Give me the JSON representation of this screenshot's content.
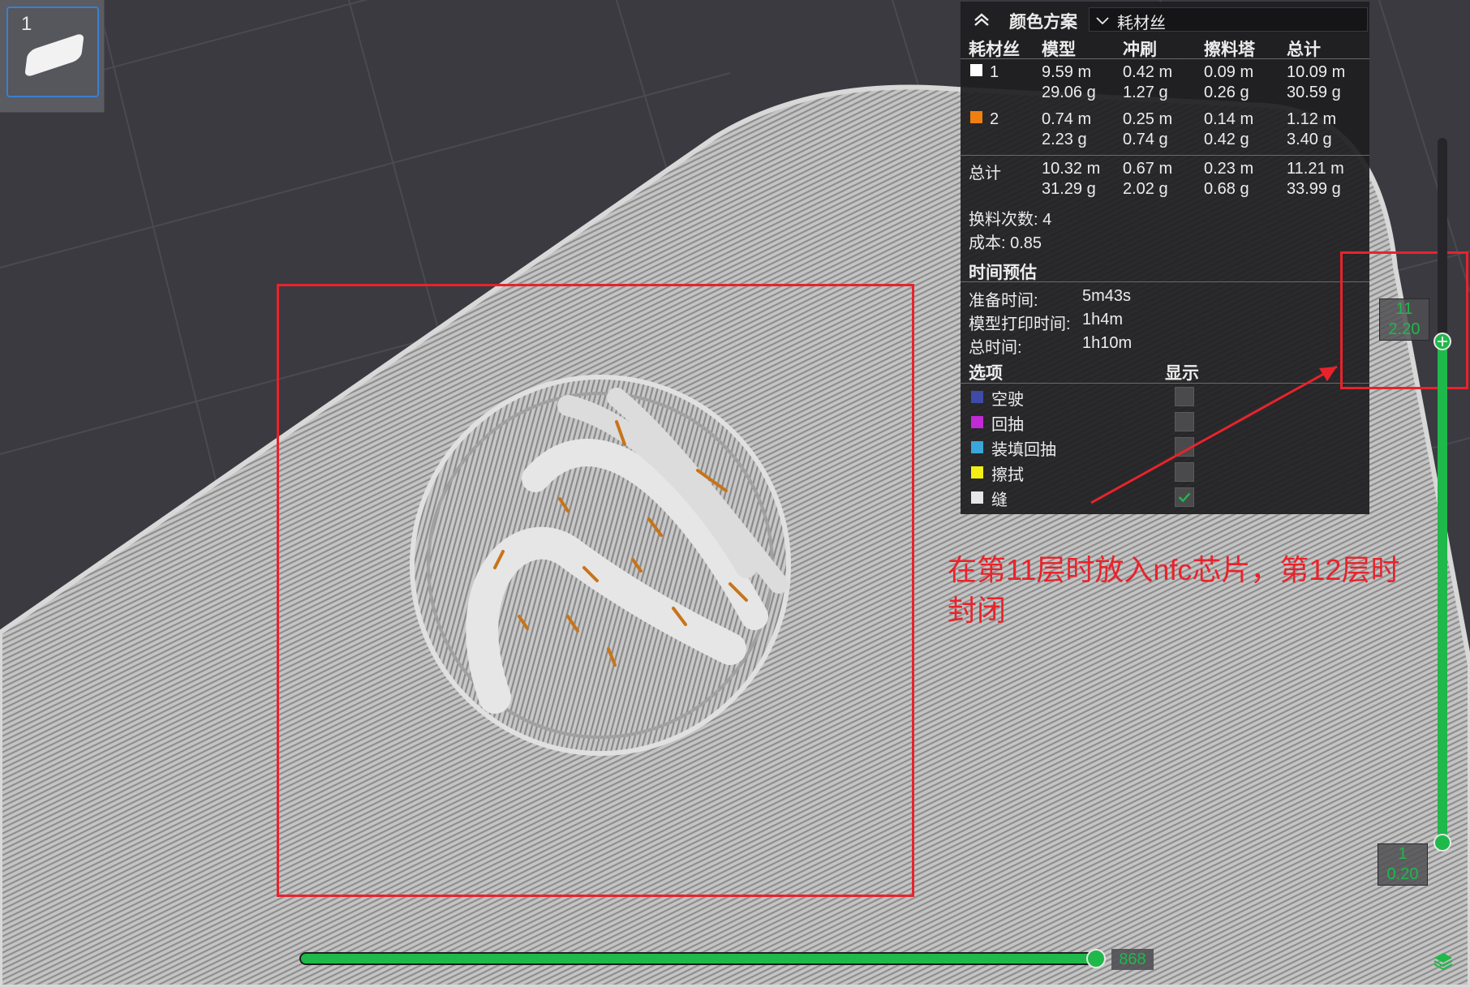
{
  "plate": {
    "number": "1"
  },
  "panel": {
    "scheme_title": "颜色方案",
    "scheme_value": "耗材丝",
    "columns": [
      "耗材丝",
      "模型",
      "冲刷",
      "擦料塔",
      "总计"
    ],
    "filaments": [
      {
        "id": "1",
        "color": "#ffffff",
        "model": [
          "9.59 m",
          "29.06 g"
        ],
        "flush": [
          "0.42 m",
          "1.27 g"
        ],
        "tower": [
          "0.09 m",
          "0.26 g"
        ],
        "total": [
          "10.09 m",
          "30.59 g"
        ]
      },
      {
        "id": "2",
        "color": "#f07f12",
        "model": [
          "0.74 m",
          "2.23 g"
        ],
        "flush": [
          "0.25 m",
          "0.74 g"
        ],
        "tower": [
          "0.14 m",
          "0.42 g"
        ],
        "total": [
          "1.12 m",
          "3.40 g"
        ]
      }
    ],
    "total_row": {
      "label": "总计",
      "model": [
        "10.32 m",
        "31.29 g"
      ],
      "flush": [
        "0.67 m",
        "2.02 g"
      ],
      "tower": [
        "0.23 m",
        "0.68 g"
      ],
      "total": [
        "11.21 m",
        "33.99 g"
      ]
    },
    "changes": "换料次数: 4",
    "cost": "成本: 0.85",
    "time_title": "时间预估",
    "times": [
      {
        "label": "准备时间:",
        "value": "5m43s"
      },
      {
        "label": "模型打印时间:",
        "value": "1h4m"
      },
      {
        "label": "总时间:",
        "value": "1h10m"
      }
    ],
    "options_title": "选项",
    "display_title": "显示",
    "options": [
      {
        "label": "空驶",
        "color": "#3e4ba8",
        "checked": false
      },
      {
        "label": "回抽",
        "color": "#c22ad6",
        "checked": false
      },
      {
        "label": "装填回抽",
        "color": "#3aa7d8",
        "checked": false
      },
      {
        "label": "擦拭",
        "color": "#f4ef14",
        "checked": false
      },
      {
        "label": "缝",
        "color": "#e6e6e6",
        "checked": true
      }
    ]
  },
  "annotation": {
    "text": "在第11层时放入nfc芯片，第12层时封闭"
  },
  "layer_slider": {
    "top_layer": "11",
    "top_height": "2.20",
    "bottom_layer": "1",
    "bottom_height": "0.20"
  },
  "move_slider": {
    "value": "868"
  },
  "colors": {
    "accent": "#1fb84a",
    "annotation": "#e8232c",
    "filament_2": "#f07f12"
  }
}
